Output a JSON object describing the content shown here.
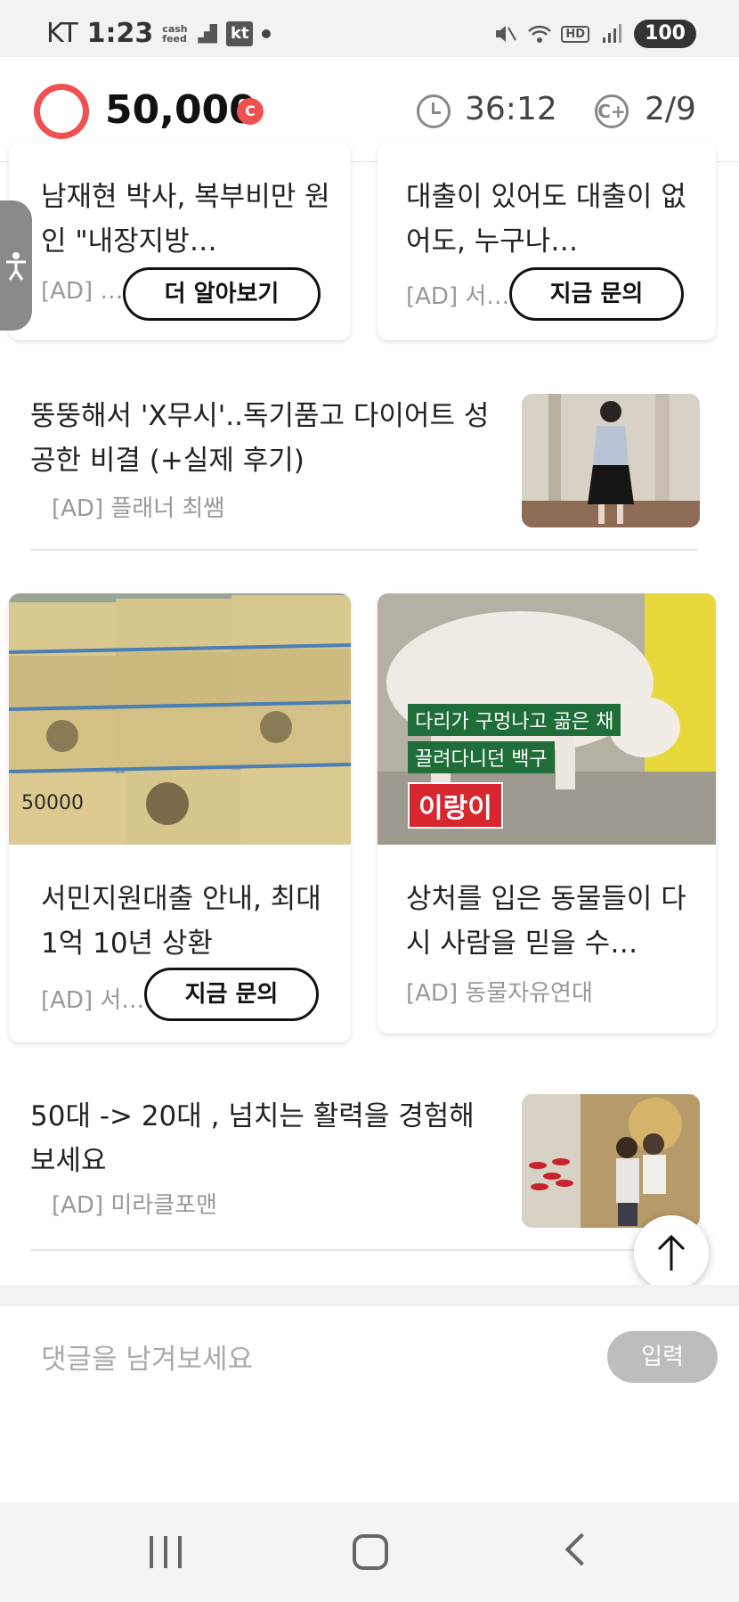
{
  "status_bar": {
    "carrier": "KT",
    "time": "1:23",
    "cashfeed_label": "cash feed",
    "kt_badge": "kt",
    "hd_label": "HD",
    "battery": "100"
  },
  "header": {
    "points": "50,000",
    "coin_symbol": "C",
    "timer": "36:12",
    "count_symbol": "C+",
    "progress": "2/9"
  },
  "accessibility_tab": {
    "icon": "accessibility-icon"
  },
  "feed": {
    "top_cards": [
      {
        "title": "남재현 박사, 복부비만 원인 \"내장지방…",
        "ad": "[AD] …",
        "button": "더 알아보기"
      },
      {
        "title": "대출이 있어도 대출이 없어도, 누구나…",
        "ad": "[AD] 서…",
        "button": "지금 문의"
      }
    ],
    "row_1": {
      "title": "뚱뚱해서 'X무시'..독기품고 다이어트 성공한 비결 (+실제 후기)",
      "ad": "[AD] 플래너 최쌤"
    },
    "grid_cards": [
      {
        "title": "서민지원대출 안내, 최대 1억 10년 상환",
        "ad": "[AD] 서…",
        "button": "지금 문의",
        "image_caption": "50000"
      },
      {
        "title": "상처를 입은 동물들이 다시 사람을 믿을 수…",
        "ad": "[AD] 동물자유연대",
        "image_caption_1": "다리가 구멍나고 곪은 채",
        "image_caption_2": "끌려다니던 백구",
        "image_caption_3": "이랑이"
      }
    ],
    "row_2": {
      "title": "50대 -> 20대 , 넘치는 활력을 경험해보세요",
      "ad": "[AD] 미라클포맨"
    }
  },
  "comment": {
    "placeholder": "댓글을 남겨보세요",
    "submit_label": "입력"
  },
  "colors": {
    "accent": "#ef5151",
    "submit_disabled": "#bdbdbd"
  }
}
